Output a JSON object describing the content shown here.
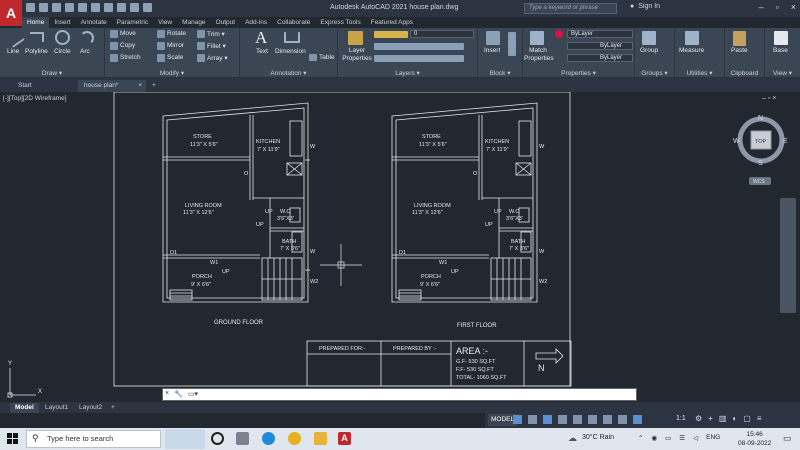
{
  "app": {
    "logo": "A",
    "window_title": "Autodesk AutoCAD 2021    house plan.dwg",
    "search_placeholder": "Type a keyword or phrase",
    "sign_in": "Sign In"
  },
  "menu_tabs": [
    "Home",
    "Insert",
    "Annotate",
    "Parametric",
    "View",
    "Manage",
    "Output",
    "Add-ins",
    "Collaborate",
    "Express Tools",
    "Featured Apps"
  ],
  "ribbon": {
    "draw": {
      "label": "Draw ▾",
      "line": "Line",
      "polyline": "Polyline",
      "circle": "Circle",
      "arc": "Arc"
    },
    "modify": {
      "label": "Modify ▾",
      "move": "Move",
      "rotate": "Rotate",
      "trim": "Trim ▾",
      "copy": "Copy",
      "mirror": "Mirror",
      "fillet": "Fillet ▾",
      "stretch": "Stretch",
      "scale": "Scale",
      "array": "Array ▾"
    },
    "annotation": {
      "label": "Annotation ▾",
      "text": "Text",
      "dimension": "Dimension",
      "table": "Table"
    },
    "layers": {
      "label": "Layers ▾",
      "layer_properties": "Layer Properties",
      "current_layer": "0"
    },
    "block": {
      "label": "Block ▾",
      "insert": "Insert"
    },
    "properties": {
      "label": "Properties ▾",
      "match": "Match Properties",
      "bylayer1": "ByLayer",
      "bylayer2": "ByLayer",
      "bylayer3": "ByLayer"
    },
    "groups": {
      "label": "Groups ▾",
      "group": "Group"
    },
    "utilities": {
      "label": "Utilities ▾",
      "measure": "Measure"
    },
    "clipboard": {
      "label": "Clipboard",
      "paste": "Paste"
    },
    "view": {
      "label": "View ▾",
      "base": "Base"
    }
  },
  "file_tabs": {
    "start": "Start",
    "house_plan": "house plan*",
    "close": "×",
    "add": "+"
  },
  "viewport_label": "[-][Top][2D Wireframe]",
  "viewport_controls": "– ▫ ×",
  "viewcube": {
    "top": "TOP",
    "n": "N",
    "s": "S",
    "e": "E",
    "w": "W",
    "wcs": "WCS"
  },
  "plan": {
    "store": "STORE",
    "store_dim": "11'3\" X 5'6\"",
    "kitchen": "KITCHEN",
    "kitchen_dim": "7' X 11'9\"",
    "living": "LIVING ROOM",
    "living_dim": "11'3\" X 12'6\"",
    "wc": "W.C",
    "wc_dim": "3'6\"X3'",
    "bath": "BATH",
    "bath_dim": "7' X 3'6\"",
    "porch": "PORCH",
    "porch_dim": "9' X 6'6\"",
    "up": "UP",
    "w": "W",
    "w1": "W1",
    "w2": "W2",
    "d1": "D1",
    "o": "O",
    "ground_floor": "GROUND FLOOR",
    "first_floor": "FIRST FLOOR"
  },
  "titleblock": {
    "prepared_for": "PREPARED FOR:-",
    "prepared_by": "PREPARED BY :-",
    "area_title": "AREA :-",
    "gf": "G.F- 530 SQ.FT",
    "ff": "F.F- 530 SQ.FT",
    "total": "TOTAL- 1060 SQ.FT",
    "north": "N"
  },
  "ucs": {
    "x": "X",
    "y": "Y"
  },
  "layout_tabs": [
    "Model",
    "Layout1",
    "Layout2"
  ],
  "layout_add": "+",
  "status": {
    "model": "MODEL",
    "scale": "1:1"
  },
  "taskbar": {
    "search": "Type here to search",
    "weather": "30°C  Rain",
    "lang": "ENG",
    "time": "15:46",
    "date": "08-09-2022"
  },
  "colors": {
    "accent": "#c0282e",
    "canvas": "#212830",
    "ribbon": "#3b4654",
    "lines": "#e6e9ec"
  }
}
